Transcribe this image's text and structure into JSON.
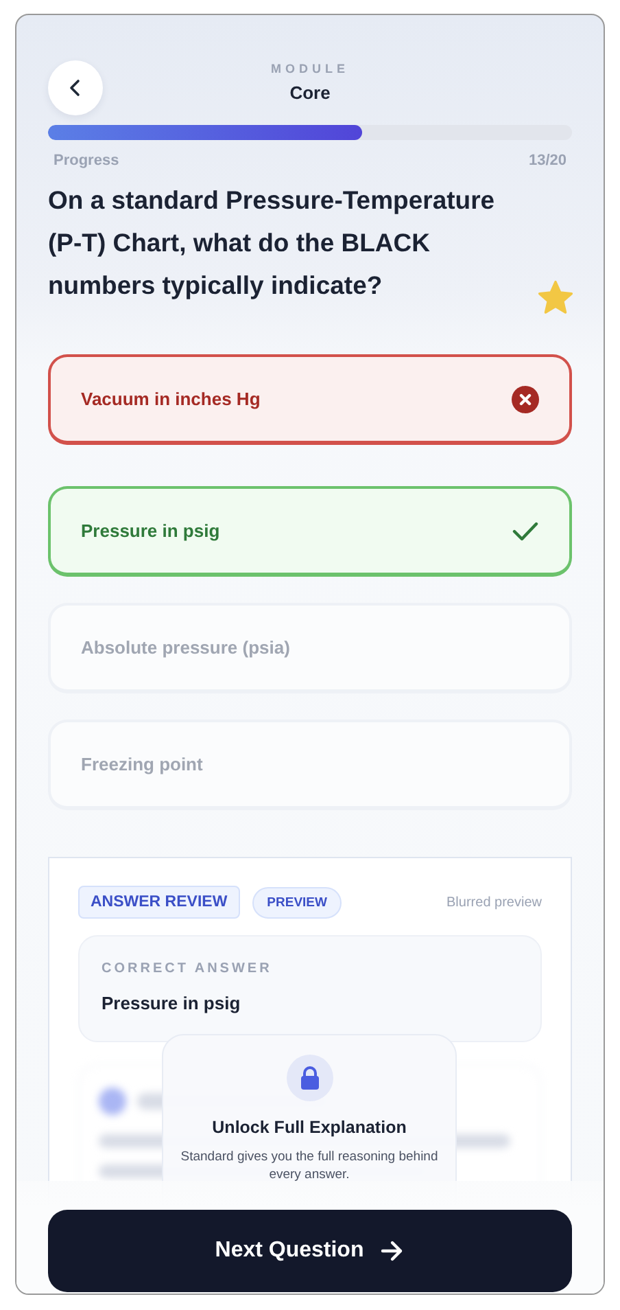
{
  "header": {
    "module_label": "MODULE",
    "module_name": "Core"
  },
  "progress": {
    "label": "Progress",
    "count": "13/20",
    "level": 0.6
  },
  "question": {
    "text": "On a standard Pressure-Temperature (P-T) Chart, what do the BLACK numbers typically indicate?",
    "starred": true
  },
  "options": [
    {
      "label": "Vacuum in inches Hg",
      "kind": "wrong"
    },
    {
      "label": "Pressure in psig",
      "kind": "correct"
    },
    {
      "label": "Absolute pressure (psia)",
      "kind": "neutral"
    },
    {
      "label": "Freezing point",
      "kind": "neutral"
    }
  ],
  "review": {
    "title": "ANSWER REVIEW",
    "badge": "PREVIEW",
    "note": "Blurred preview",
    "correct_label": "CORRECT ANSWER",
    "correct_value": "Pressure in psig",
    "unlock": {
      "title": "Unlock Full Explanation",
      "text": "Standard gives you the full reasoning behind every answer."
    }
  },
  "next_button": "Next Question"
}
